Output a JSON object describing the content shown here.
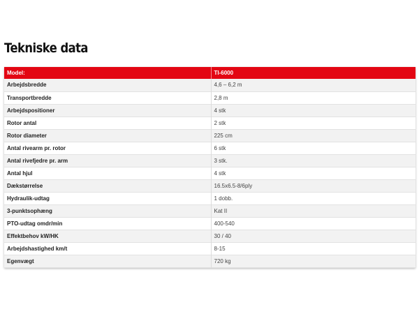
{
  "page": {
    "title": "Tekniske data"
  },
  "table": {
    "header": {
      "label": "Model:",
      "value": "TI-6000"
    },
    "rows": [
      {
        "label": "Arbejdsbredde",
        "value": "4,6 – 6,2 m"
      },
      {
        "label": "Transportbredde",
        "value": "2,8 m"
      },
      {
        "label": "Arbejdspositioner",
        "value": "4 stk"
      },
      {
        "label": "Rotor antal",
        "value": "2 stk"
      },
      {
        "label": "Rotor diameter",
        "value": "225 cm"
      },
      {
        "label": "Antal rivearm pr. rotor",
        "value": "6 stk"
      },
      {
        "label": "Antal rivefjedre pr. arm",
        "value": "3 stk."
      },
      {
        "label": "Antal hjul",
        "value": "4 stk"
      },
      {
        "label": "Dækstørrelse",
        "value": "16.5x6.5-8/6ply"
      },
      {
        "label": "Hydraulik-udtag",
        "value": "1 dobb."
      },
      {
        "label": "3-punktsophæng",
        "value": "Kat II"
      },
      {
        "label": "PTO-udtag omdr/min",
        "value": "400-540"
      },
      {
        "label": "Effektbehov kW/HK",
        "value": "30 / 40"
      },
      {
        "label": "Arbejdshastighed km/t",
        "value": "8-15"
      },
      {
        "label": "Egenvægt",
        "value": "720 kg"
      }
    ]
  },
  "colors": {
    "header_background": "#e30613",
    "header_text": "#ffffff",
    "row_alternate": "#f2f2f2"
  }
}
